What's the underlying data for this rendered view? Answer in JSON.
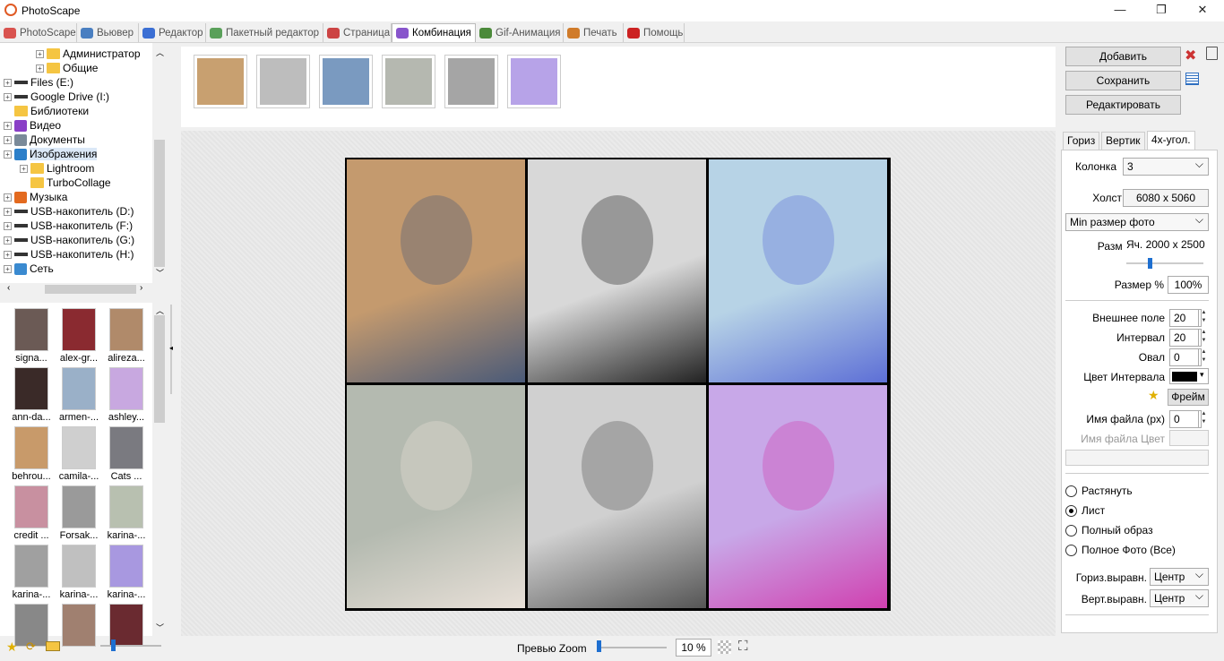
{
  "window": {
    "title": "PhotoScape",
    "minimize": "—",
    "maximize": "❐",
    "close": "✕"
  },
  "tabs": [
    {
      "label": "PhotoScape",
      "color": "#d9534f"
    },
    {
      "label": "Вьювер",
      "color": "#4a7fc1"
    },
    {
      "label": "Редактор",
      "color": "#3b6fd4"
    },
    {
      "label": "Пакетный редактор",
      "color": "#5aa05a"
    },
    {
      "label": "Страница",
      "color": "#c44"
    },
    {
      "label": "Комбинация",
      "color": "#8855cc"
    },
    {
      "label": "Gif-Анимация",
      "color": "#4b8a3a"
    },
    {
      "label": "Печать",
      "color": "#d07b2a"
    },
    {
      "label": "Помощь",
      "color": "#cc2222"
    }
  ],
  "tree": [
    {
      "label": "Администратор",
      "icon": "folder",
      "expander": true
    },
    {
      "label": "Общие",
      "icon": "folder",
      "expander": true
    },
    {
      "label": "Files (E:)",
      "icon": "drive",
      "expander": true
    },
    {
      "label": "Google Drive (I:)",
      "icon": "drive",
      "expander": true
    },
    {
      "label": "Библиотеки",
      "icon": "folder",
      "expander": false
    },
    {
      "label": "Видео",
      "icon": "video-library",
      "expander": true
    },
    {
      "label": "Документы",
      "icon": "documents-library",
      "expander": true
    },
    {
      "label": "Изображения",
      "icon": "pictures-library",
      "expander": true
    },
    {
      "label": "Lightroom",
      "icon": "folder",
      "expander": true
    },
    {
      "label": "TurboCollage",
      "icon": "folder",
      "expander": false
    },
    {
      "label": "Музыка",
      "icon": "music-library",
      "expander": true
    },
    {
      "label": "USB-накопитель (D:)",
      "icon": "drive",
      "expander": true
    },
    {
      "label": "USB-накопитель (F:)",
      "icon": "drive",
      "expander": true
    },
    {
      "label": "USB-накопитель (G:)",
      "icon": "drive",
      "expander": true
    },
    {
      "label": "USB-накопитель (H:)",
      "icon": "drive",
      "expander": true
    },
    {
      "label": "Сеть",
      "icon": "network",
      "expander": true
    }
  ],
  "thumbnails": [
    {
      "label": "signa...",
      "color": "#6b5a55"
    },
    {
      "label": "alex-gr...",
      "color": "#8a2a30"
    },
    {
      "label": "alireza...",
      "color": "#b08a6a"
    },
    {
      "label": "ann-da...",
      "color": "#3a2a28"
    },
    {
      "label": "armen-...",
      "color": "#9ab0c8"
    },
    {
      "label": "ashley...",
      "color": "#c8a8e0"
    },
    {
      "label": "behrou...",
      "color": "#c89a6a"
    },
    {
      "label": "camila-...",
      "color": "#cfcfcf"
    },
    {
      "label": "Cats ...",
      "color": "#7a7a80"
    },
    {
      "label": "credit ...",
      "color": "#c890a0"
    },
    {
      "label": "Forsak...",
      "color": "#9a9a9a"
    },
    {
      "label": "karina-...",
      "color": "#b8c0b0"
    },
    {
      "label": "karina-...",
      "color": "#a0a0a0"
    },
    {
      "label": "karina-...",
      "color": "#c0c0c0"
    },
    {
      "label": "karina-...",
      "color": "#a898e0"
    },
    {
      "label": "",
      "color": "#888"
    },
    {
      "label": "",
      "color": "#a08070"
    },
    {
      "label": "",
      "color": "#6a2a30"
    }
  ],
  "filmstrip": [
    {
      "name": "photo-1",
      "color": "#c8a070"
    },
    {
      "name": "photo-2",
      "color": "#bdbdbd"
    },
    {
      "name": "photo-3",
      "color": "#7a9ac0"
    },
    {
      "name": "photo-4",
      "color": "#b5b8b0"
    },
    {
      "name": "photo-5",
      "color": "#a5a5a5"
    },
    {
      "name": "photo-6",
      "color": "#b7a3e8"
    }
  ],
  "collage_cells": [
    {
      "color": "#c49a6e",
      "accent": "#4a5a78"
    },
    {
      "color": "#d8d8d8",
      "accent": "#222222"
    },
    {
      "color": "#b7d3e6",
      "accent": "#5d6fd6"
    },
    {
      "color": "#b4bab0",
      "accent": "#e8e0d8"
    },
    {
      "color": "#d0d0d0",
      "accent": "#555555"
    },
    {
      "color": "#c8a8e8",
      "accent": "#d040b0"
    }
  ],
  "bottom": {
    "zoom_label": "Превью Zoom",
    "zoom_value": "10 %"
  },
  "right": {
    "add": "Добавить",
    "save": "Сохранить",
    "edit": "Редактировать",
    "tabs": [
      "Гориз",
      "Вертик",
      "4х-угол."
    ],
    "column_label": "Колонка",
    "column_value": "3",
    "canvas_label": "Холст",
    "canvas_value": "6080 x 5060",
    "min_size": "Min размер фото",
    "size_label": "Размер",
    "size_value": "Яч. 2000 x 2500",
    "size_pct_label": "Размер %",
    "size_pct_value": "100%",
    "outer_label": "Внешнее поле",
    "outer_value": "20",
    "interval_label": "Интервал",
    "interval_value": "20",
    "oval_label": "Овал",
    "oval_value": "0",
    "interval_color_label": "Цвет Интервала",
    "interval_color": "#000000",
    "frame_button": "Фрейм",
    "filename_label": "Имя файла (px)",
    "filename_value": "0",
    "filename_color_label": "Имя файла Цвет",
    "radios": [
      {
        "label": "Растянуть",
        "checked": false
      },
      {
        "label": "Лист",
        "checked": true
      },
      {
        "label": "Полный образ",
        "checked": false
      },
      {
        "label": "Полное Фото (Все)",
        "checked": false
      }
    ],
    "halign_label": "Гориз.выравн.",
    "halign_value": "Центр",
    "valign_label": "Верт.выравн.",
    "valign_value": "Центр"
  }
}
